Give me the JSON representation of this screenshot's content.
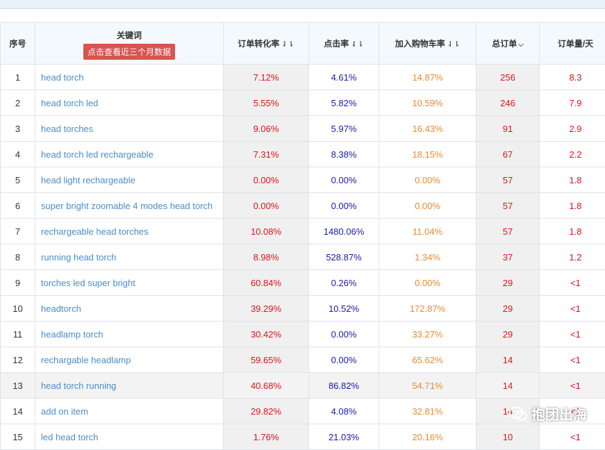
{
  "table": {
    "headers": {
      "index": "序号",
      "keyword": "关键词",
      "keyword_button": "点击查看近三个月数据",
      "conversion": "订单转化率",
      "click_rate": "点击率",
      "cart_rate": "加入购物车率",
      "total_orders": "总订单",
      "daily_orders": "订单量/天"
    },
    "rows": [
      {
        "index": "1",
        "keyword": "head torch",
        "conversion": "7.12%",
        "click_rate": "4.61%",
        "cart_rate": "14.87%",
        "total_orders": "256",
        "daily_orders": "8.3"
      },
      {
        "index": "2",
        "keyword": "head torch led",
        "conversion": "5.55%",
        "click_rate": "5.82%",
        "cart_rate": "10.59%",
        "total_orders": "246",
        "daily_orders": "7.9"
      },
      {
        "index": "3",
        "keyword": "head torches",
        "conversion": "9.06%",
        "click_rate": "5.97%",
        "cart_rate": "16.43%",
        "total_orders": "91",
        "daily_orders": "2.9"
      },
      {
        "index": "4",
        "keyword": "head torch led rechargeable",
        "conversion": "7.31%",
        "click_rate": "8.38%",
        "cart_rate": "18.15%",
        "total_orders": "67",
        "daily_orders": "2.2"
      },
      {
        "index": "5",
        "keyword": "head light rechargeable",
        "conversion": "0.00%",
        "click_rate": "0.00%",
        "cart_rate": "0.00%",
        "total_orders": "57",
        "daily_orders": "1.8"
      },
      {
        "index": "6",
        "keyword": "super bright zoomable 4 modes head torch",
        "conversion": "0.00%",
        "click_rate": "0.00%",
        "cart_rate": "0.00%",
        "total_orders": "57",
        "daily_orders": "1.8"
      },
      {
        "index": "7",
        "keyword": "rechargeable head torches",
        "conversion": "10.08%",
        "click_rate": "1480.06%",
        "cart_rate": "11.04%",
        "total_orders": "57",
        "daily_orders": "1.8"
      },
      {
        "index": "8",
        "keyword": "running head torch",
        "conversion": "8.98%",
        "click_rate": "528.87%",
        "cart_rate": "1.34%",
        "total_orders": "37",
        "daily_orders": "1.2"
      },
      {
        "index": "9",
        "keyword": "torches led super bright",
        "conversion": "60.84%",
        "click_rate": "0.26%",
        "cart_rate": "0.00%",
        "total_orders": "29",
        "daily_orders": "<1"
      },
      {
        "index": "10",
        "keyword": "headtorch",
        "conversion": "39.29%",
        "click_rate": "10.52%",
        "cart_rate": "172.87%",
        "total_orders": "29",
        "daily_orders": "<1"
      },
      {
        "index": "11",
        "keyword": "headlamp torch",
        "conversion": "30.42%",
        "click_rate": "0.00%",
        "cart_rate": "33.27%",
        "total_orders": "29",
        "daily_orders": "<1"
      },
      {
        "index": "12",
        "keyword": "rechargable headlamp",
        "conversion": "59.65%",
        "click_rate": "0.00%",
        "cart_rate": "65.62%",
        "total_orders": "14",
        "daily_orders": "<1"
      },
      {
        "index": "13",
        "keyword": "head torch running",
        "conversion": "40.68%",
        "click_rate": "86.82%",
        "cart_rate": "54.71%",
        "total_orders": "14",
        "daily_orders": "<1"
      },
      {
        "index": "14",
        "keyword": "add on item",
        "conversion": "29.82%",
        "click_rate": "4.08%",
        "cart_rate": "32.81%",
        "total_orders": "14",
        "daily_orders": "<1"
      },
      {
        "index": "15",
        "keyword": "led head torch",
        "conversion": "1.76%",
        "click_rate": "21.03%",
        "cart_rate": "20.16%",
        "total_orders": "10",
        "daily_orders": "<1"
      }
    ]
  },
  "watermark": {
    "text": "抱团出海"
  },
  "colors": {
    "header_bg": "#f4f9fe",
    "keyword_link": "#4a8dc9",
    "red_value": "#e0101a",
    "blue_value": "#1a1aa6",
    "orange_value": "#ea8a2e",
    "button_bg": "#d9534f"
  },
  "icons": {
    "sort": "sort-arrows-icon",
    "dropdown": "chevron-down-icon",
    "watermark_logo": "wechat-icon"
  }
}
